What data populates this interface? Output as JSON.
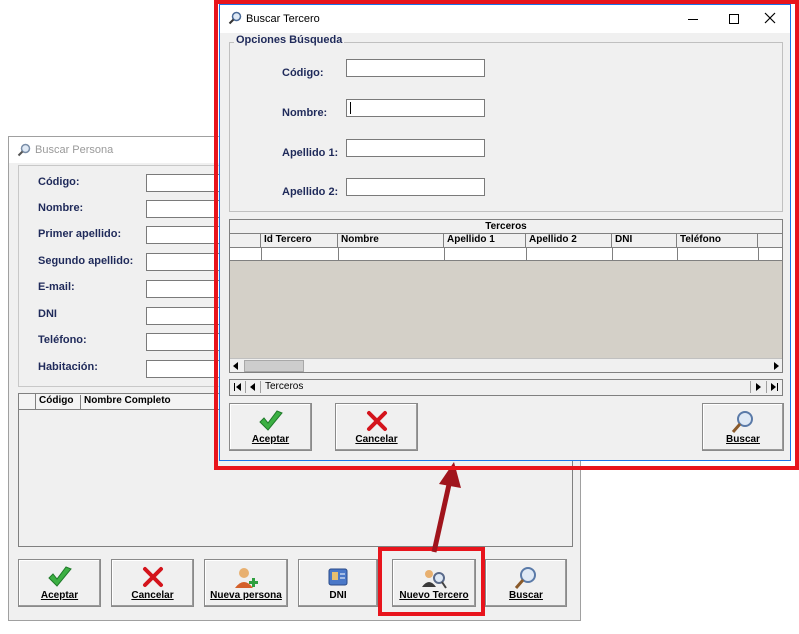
{
  "back_window": {
    "title": "Buscar Persona",
    "fields": [
      {
        "label": "Código:"
      },
      {
        "label": "Nombre:"
      },
      {
        "label": "Primer apellido:"
      },
      {
        "label": "Segundo apellido:"
      },
      {
        "label": "E-mail:"
      },
      {
        "label": "DNI"
      },
      {
        "label": "Teléfono:"
      },
      {
        "label": "Habitación:"
      }
    ],
    "grid_headers": [
      "Código",
      "Nombre Completo"
    ],
    "buttons": {
      "accept": "Aceptar",
      "cancel": "Cancelar",
      "new_person": "Nueva persona",
      "dni": "DNI",
      "new_third": "Nuevo Tercero",
      "search": "Buscar"
    }
  },
  "front_window": {
    "title": "Buscar Tercero",
    "group_title": "Opciones Búsqueda",
    "fields": [
      {
        "label": "Código:"
      },
      {
        "label": "Nombre:"
      },
      {
        "label": "Apellido 1:"
      },
      {
        "label": "Apellido 2:"
      }
    ],
    "grid": {
      "caption": "Terceros",
      "headers": [
        "Id Tercero",
        "Nombre",
        "Apellido 1",
        "Apellido 2",
        "DNI",
        "Teléfono"
      ]
    },
    "navigator_label": "Terceros",
    "buttons": {
      "accept": "Aceptar",
      "cancel": "Cancelar",
      "search": "Buscar"
    }
  },
  "colors": {
    "highlight": "#e8141c",
    "label_text": "#1f2a5a",
    "arrow": "#a0141c"
  }
}
